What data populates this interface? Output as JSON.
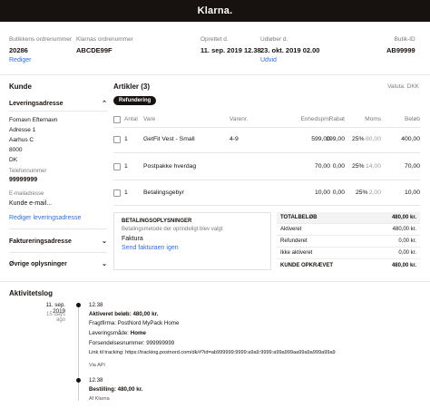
{
  "header": {
    "logo": "Klarna."
  },
  "meta": {
    "store_order_label": "Butikkens ordrenummer",
    "store_order_value": "20286",
    "edit_link": "Rediger",
    "klarna_order_label": "Klarnas ordrenummer",
    "klarna_order_value": "ABCDE99F",
    "created_label": "Oprettet d.",
    "created_value": "11. sep. 2019 12.38",
    "expires_label": "Udløber d.",
    "expires_value": "23. okt. 2019 02.00",
    "extend_link": "Udvid",
    "store_id_label": "Butik-ID",
    "store_id_value": "AB99999"
  },
  "customer": {
    "title": "Kunde",
    "shipping_address_label": "Leveringsadresse",
    "name": "Fornavn Efternavn",
    "address": "Adresse 1",
    "city": "Aarhus C",
    "zip": "8000",
    "country": "DK",
    "phone_label": "Telefonnummer",
    "phone_value": "99999999",
    "email_label": "E-mailadresse",
    "email_value": "Kunde e-mail...",
    "edit_shipping_link": "Rediger leveringsadresse",
    "billing_address_label": "Faktureringsadresse",
    "other_info_label": "Øvrige oplysninger"
  },
  "articles": {
    "title": "Artikler (3)",
    "refund_button": "Refundering",
    "currency": "Valuta: DKK",
    "columns": [
      "Antal",
      "Vare",
      "Varenr.",
      "Enhedspris",
      "Rabat",
      "Moms",
      "Beløb"
    ],
    "rows": [
      {
        "qty": "1",
        "name": "GetFit Vest - Small",
        "sku": "4-9",
        "unit": "599,00",
        "discount": "199,00",
        "vat_pct": "25%",
        "vat": "80,00",
        "amount": "400,00"
      },
      {
        "qty": "1",
        "name": "Postpakke hverdag",
        "sku": "",
        "unit": "70,00",
        "discount": "0,00",
        "vat_pct": "25%",
        "vat": "14,00",
        "amount": "70,00"
      },
      {
        "qty": "1",
        "name": "Betalingsgebyr",
        "sku": "",
        "unit": "10,00",
        "discount": "0,00",
        "vat_pct": "25%",
        "vat": "2,00",
        "amount": "10,00"
      }
    ]
  },
  "payment": {
    "title": "BETALINGSOPLYSNINGER",
    "subtitle": "Betalingsmetode der oprindeligt blev valgt",
    "method": "Faktura",
    "send_invoice_link": "Send fakturaen igen"
  },
  "totals": {
    "total_label": "TOTALBELØB",
    "total_value": "480,00 kr.",
    "activated_label": "Aktiveret",
    "activated_value": "480,00 kr.",
    "refunded_label": "Refunderet",
    "refunded_value": "0,00 kr.",
    "not_activated_label": "Ikke aktiveret",
    "not_activated_value": "0,00 kr.",
    "customer_paid_label": "KUNDE OPKRÆVET",
    "customer_paid_value": "480,00 kr."
  },
  "activity": {
    "title": "Aktivitetslog",
    "date": "11. sep. 2019",
    "ago": "15 days ago",
    "entry1": {
      "time": "12.38",
      "activated_prefix": "Aktiveret beløb: ",
      "activated_value": "480,00 kr.",
      "carrier_prefix": "Fragtfirma: ",
      "carrier_value": "PostNord MyPack Home",
      "method_prefix": "Leveringsmåde: ",
      "method_value": "Home",
      "tracking_no_prefix": "Forsendelsesnummer: ",
      "tracking_no_value": "999999999",
      "link_prefix": "Link til tracking: ",
      "link_value": "https://tracking.postnord.com/dk/#?id=ab999999:9999:a9a9:9999:a99a999aa99a9a999a99a9",
      "source": "Via API"
    },
    "entry2": {
      "time": "12.38",
      "order_prefix": "Bestilling: ",
      "order_value": "480,00 kr.",
      "source": "Af Klarna"
    }
  }
}
